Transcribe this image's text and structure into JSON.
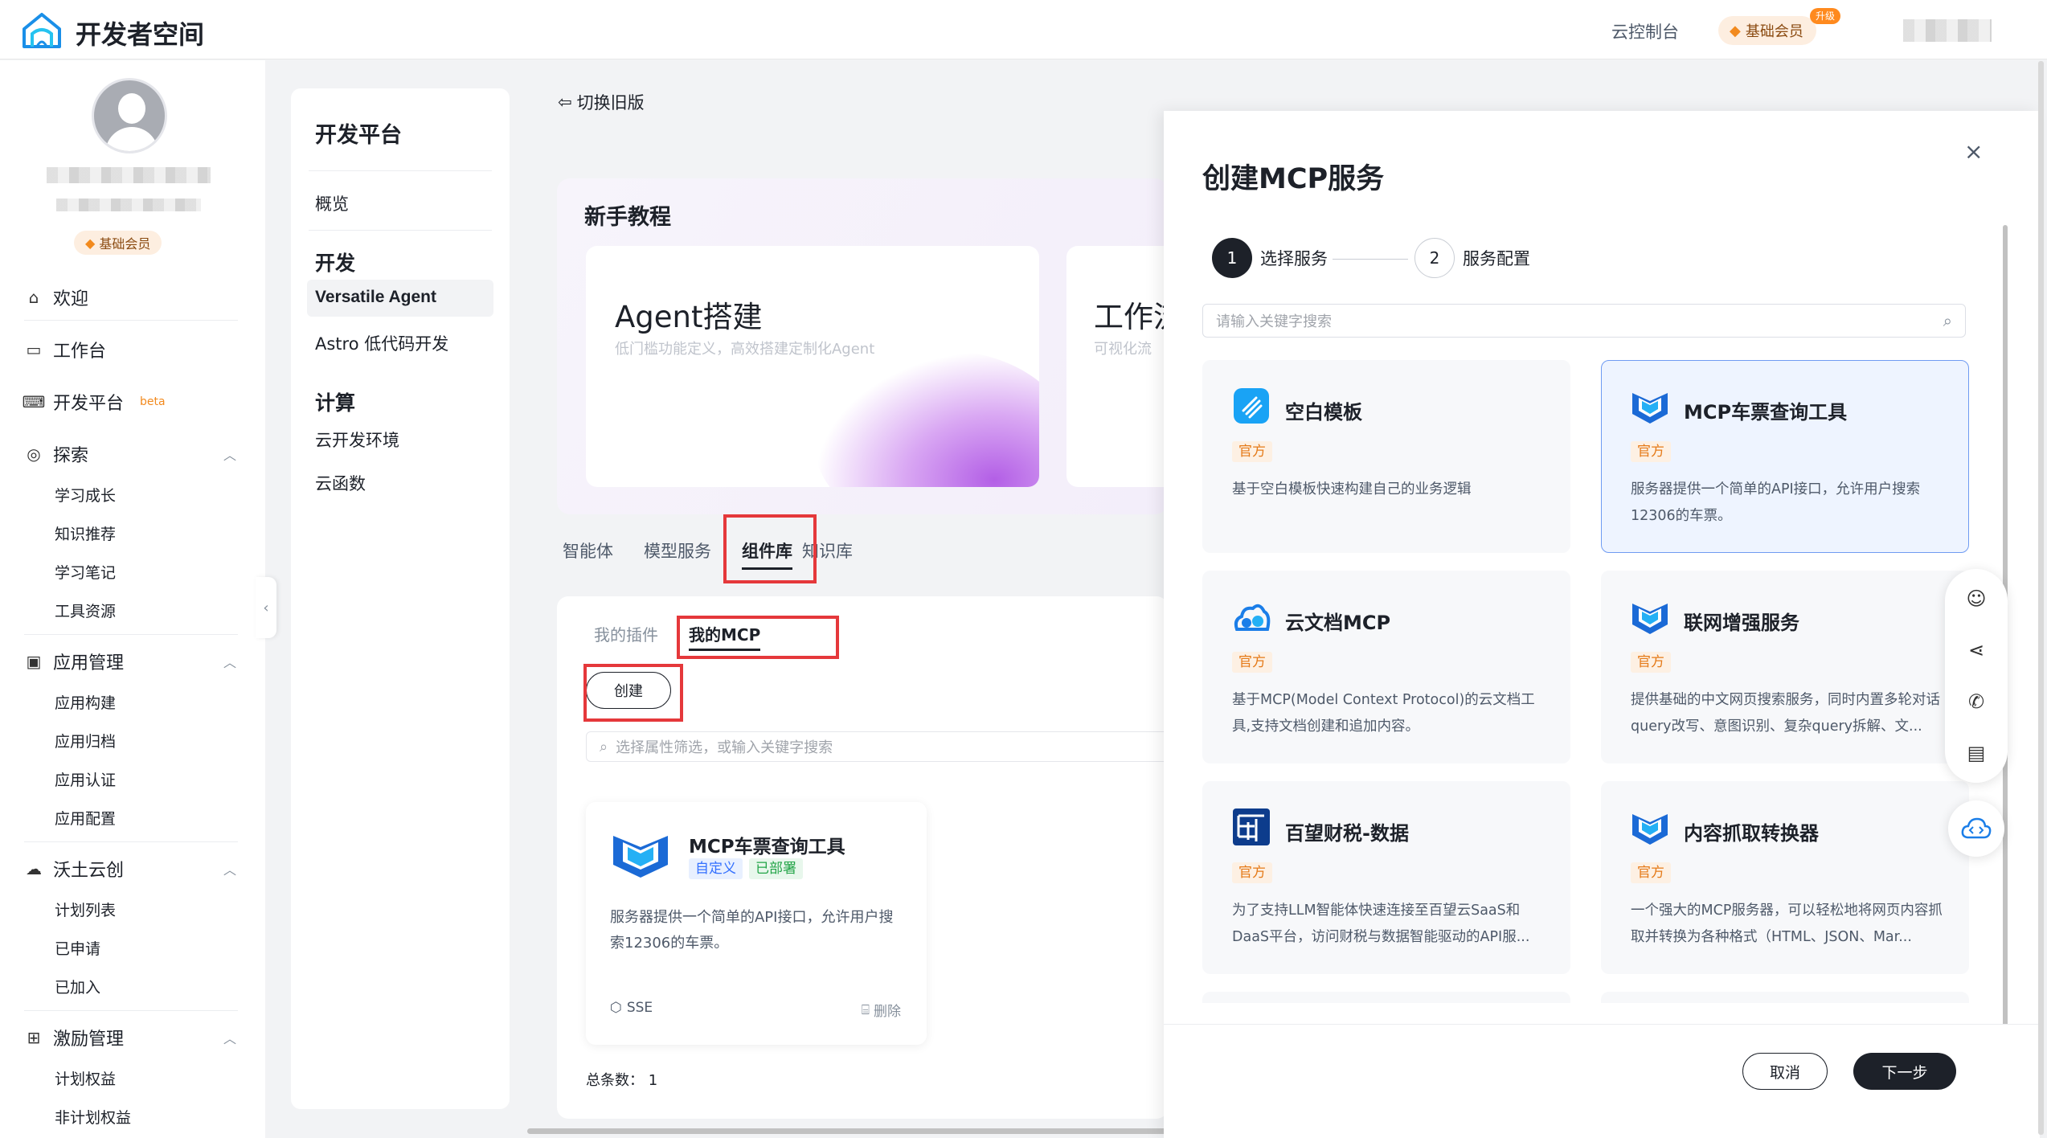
{
  "topbar": {
    "brand": "开发者空间",
    "console": "云控制台",
    "vip": "基础会员",
    "upgrade": "升级"
  },
  "leftnav": {
    "vip": "基础会员",
    "items": {
      "welcome": "欢迎",
      "workbench": "工作台",
      "devplatform": "开发平台",
      "beta": "beta",
      "explore": "探索",
      "appmgmt": "应用管理",
      "woto": "沃土云创",
      "incentive": "激励管理"
    },
    "explore_sub": [
      "学习成长",
      "知识推荐",
      "学习笔记",
      "工具资源"
    ],
    "app_sub": [
      "应用构建",
      "应用归档",
      "应用认证",
      "应用配置"
    ],
    "woto_sub": [
      "计划列表",
      "已申请",
      "已加入"
    ],
    "incentive_sub": [
      "计划权益",
      "非计划权益"
    ]
  },
  "platmenu": {
    "title": "开发平台",
    "overview": "概览",
    "dev_group": "开发",
    "versatile": "Versatile Agent",
    "astro": "Astro 低代码开发",
    "compute_group": "计算",
    "cloud_env": "云开发环境",
    "cloud_fn": "云函数"
  },
  "main": {
    "switch_old": "切换旧版",
    "tutorial_title": "新手教程",
    "card1_title": "Agent搭建",
    "card1_sub": "低门槛功能定义，高效搭建定制化Agent",
    "card2_title": "工作流",
    "card2_sub": "可视化流",
    "tabs": [
      "智能体",
      "模型服务",
      "组件库",
      "知识库"
    ],
    "subtab_plugins": "我的插件",
    "subtab_mcp": "我的MCP",
    "create": "创建",
    "filter_placeholder": "选择属性筛选，或输入关键字搜索",
    "card": {
      "name": "MCP车票查询工具",
      "tag_custom": "自定义",
      "tag_deployed": "已部署",
      "desc": "服务器提供一个简单的API接口，允许用户搜索12306的车票。",
      "sse": "SSE",
      "delete": "删除"
    },
    "total": "总条数： 1"
  },
  "drawer": {
    "title": "创建MCP服务",
    "step1_num": "1",
    "step1": "选择服务",
    "step2_num": "2",
    "step2": "服务配置",
    "search_placeholder": "请输入关键字搜索",
    "official": "官方",
    "services": [
      {
        "name": "空白模板",
        "desc": "基于空白模板快速构建自己的业务逻辑"
      },
      {
        "name": "MCP车票查询工具",
        "desc": "服务器提供一个简单的API接口，允许用户搜索12306的车票。"
      },
      {
        "name": "云文档MCP",
        "desc": "基于MCP(Model Context Protocol)的云文档工具,支持文档创建和追加内容。"
      },
      {
        "name": "联网增强服务",
        "desc": "提供基础的中文网页搜索服务，同时内置多轮对话query改写、意图识别、复杂query拆解、文..."
      },
      {
        "name": "百望财税-数据",
        "desc": "为了支持LLM智能体快速连接至百望云SaaS和DaaS平台，访问财税与数据智能驱动的API服..."
      },
      {
        "name": "内容抓取转换器",
        "desc": "一个强大的MCP服务器，可以轻松地将网页内容抓取并转换为各种格式（HTML、JSON、Mar..."
      }
    ],
    "cancel": "取消",
    "next": "下一步"
  }
}
